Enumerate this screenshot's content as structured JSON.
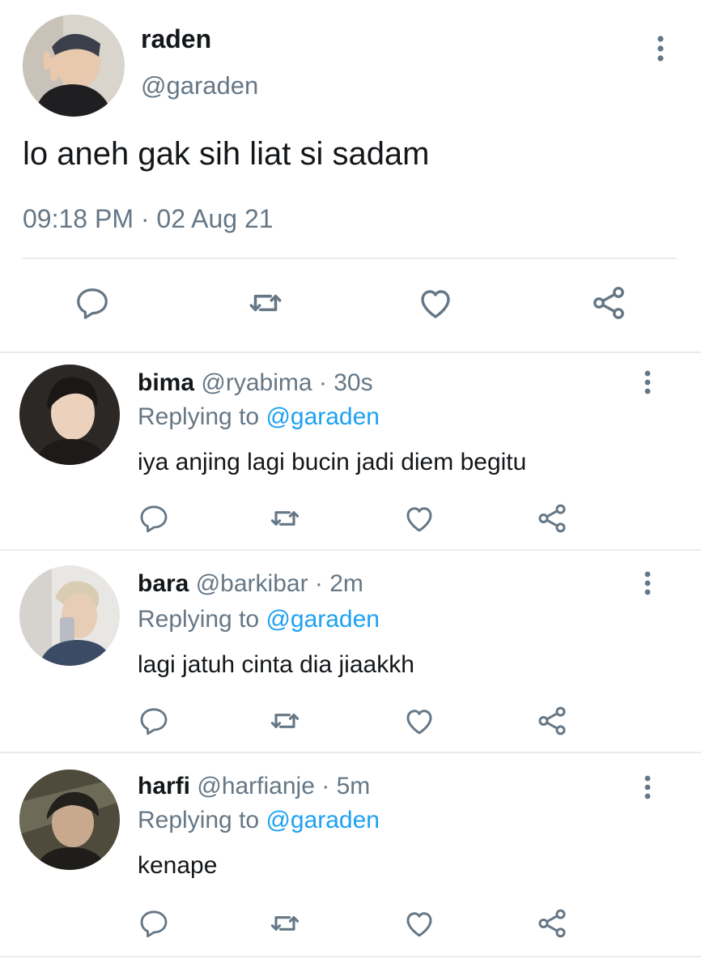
{
  "main_tweet": {
    "name": "raden",
    "handle": "@garaden",
    "text": "lo aneh gak sih liat si sadam",
    "timestamp": "09:18 PM · 02 Aug 21"
  },
  "replies": [
    {
      "name": "bima",
      "handle": "@ryabima",
      "time": "· 30s",
      "replying_prefix": "Replying to ",
      "replying_handle": "@garaden",
      "text": "iya anjing lagi bucin jadi diem begitu"
    },
    {
      "name": "bara",
      "handle": "@barkibar",
      "time": "· 2m",
      "replying_prefix": "Replying to ",
      "replying_handle": "@garaden",
      "text": "lagi jatuh cinta dia jiaakkh"
    },
    {
      "name": "harfi",
      "handle": "@harfianje",
      "time": "· 5m",
      "replying_prefix": "Replying to ",
      "replying_handle": "@garaden",
      "text": "kenape"
    }
  ],
  "icons": {
    "reply": "reply-icon",
    "retweet": "retweet-icon",
    "like": "like-icon",
    "share": "share-icon",
    "more": "more-vertical-icon"
  },
  "colors": {
    "text": "#14171a",
    "secondary": "#657786",
    "accent": "#1da1f2",
    "divider": "#e6ecf0"
  }
}
